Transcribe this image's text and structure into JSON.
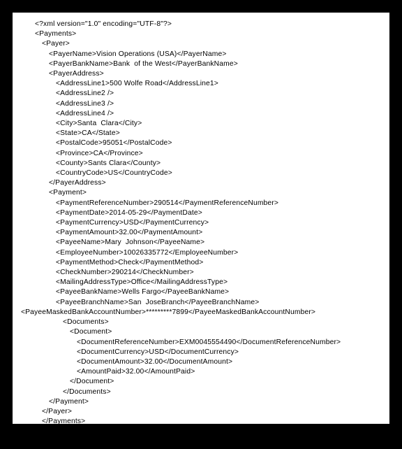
{
  "xml": {
    "declaration": "<?xml version=\"1.0\" encoding=\"UTF-8\"?>",
    "paymentsOpen": "<Payments>",
    "payerOpen": "<Payer>",
    "payerName": "<PayerName>Vision Operations (USA)</PayerName>",
    "payerBankName": "<PayerBankName>Bank  of the West</PayerBankName>",
    "payerAddressOpen": "<PayerAddress>",
    "addr1": "<AddressLine1>500 Wolfe Road</AddressLine1>",
    "addr2": "<AddressLine2 />",
    "addr3": "<AddressLine3 />",
    "addr4": "<AddressLine4 />",
    "city": "<City>Santa  Clara</City>",
    "state": "<State>CA</State>",
    "postal": "<PostalCode>95051</PostalCode>",
    "province": "<Province>CA</Province>",
    "county": "<County>Sants Clara</County>",
    "country": "<CountryCode>US</CountryCode>",
    "payerAddressClose": "</PayerAddress>",
    "paymentOpen": "<Payment>",
    "payRef": "<PaymentReferenceNumber>290514</PaymentReferenceNumber>",
    "payDate": "<PaymentDate>2014-05-29</PaymentDate>",
    "payCurrency": "<PaymentCurrency>USD</PaymentCurrency>",
    "payAmount": "<PaymentAmount>32.00</PaymentAmount>",
    "payeeName": "<PayeeName>Mary  Johnson</PayeeName>",
    "empNum": "<EmployeeNumber>10026335772</EmployeeNumber>",
    "payMethod": "<PaymentMethod>Check</PaymentMethod>",
    "checkNum": "<CheckNumber>290214</CheckNumber>",
    "mailType": "<MailingAddressType>Office</MailingAddressType>",
    "payeeBank": "<PayeeBankName>Wells Fargo</PayeeBankName>",
    "payeeBranch": "<PayeeBranchName>San  JoseBranch</PayeeBranchName>",
    "maskedAcct": "<PayeeMaskedBankAccountNumber>*********7899</PayeeMaskedBankAccountNumber>",
    "documentsOpen": "<Documents>",
    "documentOpen": "<Document>",
    "docRef": "<DocumentReferenceNumber>EXM0045554490</DocumentReferenceNumber>",
    "docCurrency": "<DocumentCurrency>USD</DocumentCurrency>",
    "docAmount": "<DocumentAmount>32.00</DocumentAmount>",
    "amtPaid": "<AmountPaid>32.00</AmountPaid>",
    "documentClose": "</Document>",
    "documentsClose": "</Documents>",
    "paymentClose": "</Payment>",
    "payerClose": "</Payer>",
    "paymentsClose": "</Payments>"
  }
}
